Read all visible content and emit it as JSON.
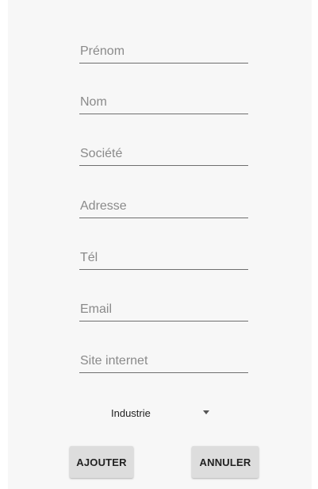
{
  "form": {
    "fields": [
      {
        "placeholder": "Prénom",
        "value": ""
      },
      {
        "placeholder": "Nom",
        "value": ""
      },
      {
        "placeholder": "Société",
        "value": ""
      },
      {
        "placeholder": "Adresse",
        "value": ""
      },
      {
        "placeholder": "Tél",
        "value": ""
      },
      {
        "placeholder": "Email",
        "value": ""
      },
      {
        "placeholder": "Site internet",
        "value": ""
      }
    ],
    "industry_select": {
      "selected": "Industrie",
      "icon": "dropdown-arrow-icon"
    },
    "buttons": {
      "add_label": "AJOUTER",
      "cancel_label": "ANNULER"
    }
  }
}
